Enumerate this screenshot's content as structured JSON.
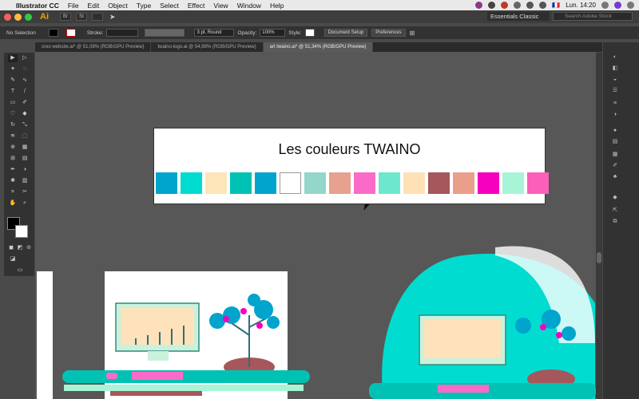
{
  "menubar": {
    "apple": "",
    "app_name": "Illustrator CC",
    "items": [
      "File",
      "Edit",
      "Object",
      "Type",
      "Select",
      "Effect",
      "View",
      "Window",
      "Help"
    ],
    "clock": "Lun. 14:20",
    "flag": "🇫🇷"
  },
  "app": {
    "logo": "Ai",
    "workspace": "Essentials Classic",
    "search_placeholder": "Search Adobe Stock",
    "bridge": "Br",
    "stock": "St"
  },
  "control": {
    "selection": "No Selection",
    "stroke_label": "Stroke:",
    "stroke_style": "3 pt. Round",
    "opacity_label": "Opacity:",
    "opacity_value": "100%",
    "style_label": "Style:",
    "document_setup": "Document Setup",
    "preferences": "Preferences"
  },
  "tabs": [
    {
      "label": "creo website.ai* @ 51,08% (RGB/GPU Preview)",
      "active": false
    },
    {
      "label": "twaino-logo.ai @ 54,98% (RGB/GPU Preview)",
      "active": false
    },
    {
      "label": "art twaino.ai* @ 51,34% (RGB/GPU Preview)",
      "active": true
    }
  ],
  "palette": {
    "title": "Les couleurs TWAINO",
    "colors": [
      "#00a5cc",
      "#00dcd0",
      "#fde5b9",
      "#00c2b4",
      "#00a4cc",
      "#ffffff",
      "#93d6ca",
      "#e6a28e",
      "#fa6bc8",
      "#6de8cc",
      "#fee1b5",
      "#a5575b",
      "#e99f89",
      "#f600c0",
      "#a8f4d6",
      "#fb5fba"
    ]
  },
  "icons": {
    "apple": "apple-icon",
    "search": "search-icon",
    "wifi": "wifi-icon",
    "arrow": "selection-tool-icon"
  }
}
